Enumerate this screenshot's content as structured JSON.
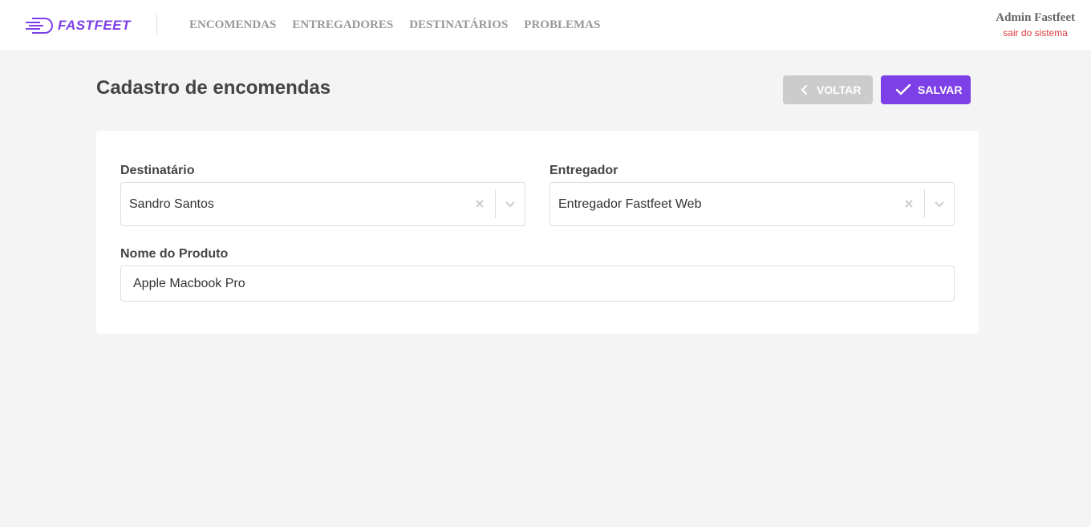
{
  "header": {
    "logo_text": "FASTFEET",
    "nav": [
      {
        "label": "ENCOMENDAS"
      },
      {
        "label": "ENTREGADORES"
      },
      {
        "label": "DESTINATÁRIOS"
      },
      {
        "label": "PROBLEMAS"
      }
    ],
    "profile": {
      "name": "Admin Fastfeet",
      "logout": "sair do sistema"
    }
  },
  "page": {
    "title": "Cadastro de encomendas",
    "back_label": "VOLTAR",
    "save_label": "SALVAR"
  },
  "form": {
    "recipient": {
      "label": "Destinatário",
      "value": "Sandro Santos"
    },
    "deliveryman": {
      "label": "Entregador",
      "value": "Entregador Fastfeet Web"
    },
    "product": {
      "label": "Nome do Produto",
      "value": "Apple Macbook Pro"
    }
  },
  "colors": {
    "brand": "#7d40e7",
    "logout": "#de3b3b",
    "back_button": "#cccccc",
    "background": "#f4f4f4"
  },
  "icons": {
    "logo": "truck-lines-icon",
    "back": "chevron-left-icon",
    "save": "check-icon",
    "clear": "close-icon",
    "dropdown": "chevron-down-icon"
  }
}
